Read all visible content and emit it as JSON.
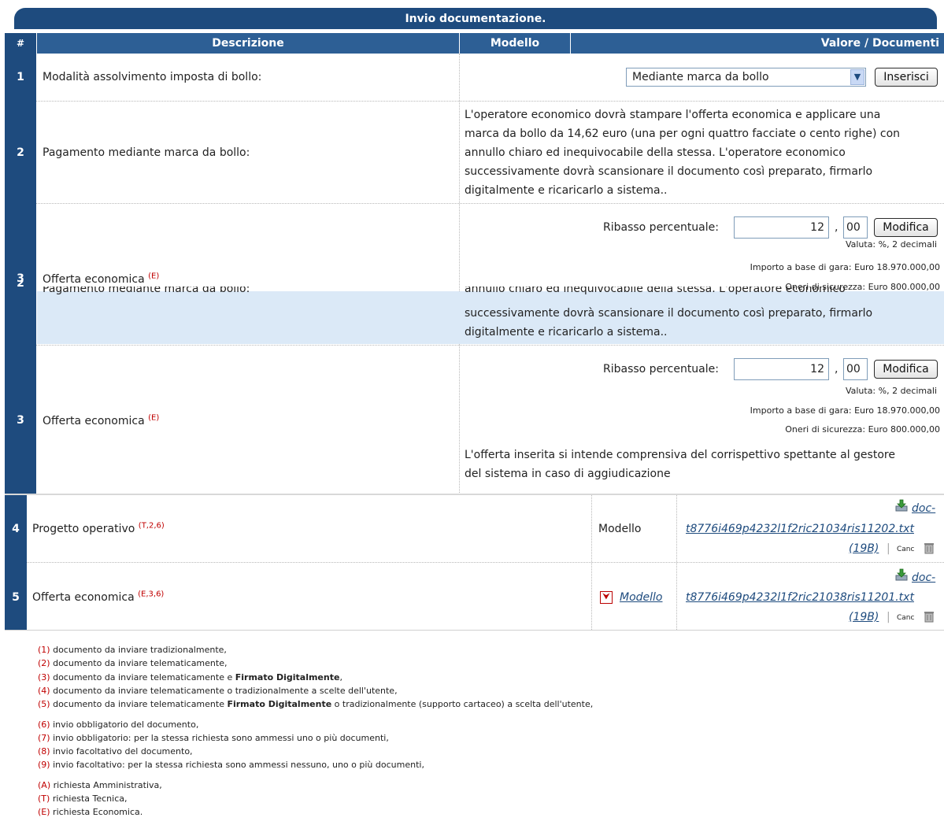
{
  "table": {
    "caption": "Invio documentazione.",
    "headers": {
      "num": "#",
      "descrizione": "Descrizione",
      "modello": "Modello",
      "valore": "Valore / Documenti"
    }
  },
  "rows": [
    {
      "num": "1",
      "desc": "Modalità assolvimento imposta di bollo:",
      "select_value": "Mediante marca da bollo",
      "button": "Inserisci"
    },
    {
      "num": "2",
      "desc": "Pagamento mediante marca da bollo:",
      "text_lines": [
        "L'operatore economico dovrà stampare l'offerta economica e applicare una",
        "marca da bollo da 14,62 euro (una per ogni quattro facciate o cento righe) con",
        "annullo chiaro ed inequivocabile della stessa. L'operatore economico",
        "successivamente dovrà scansionare il documento così preparato, firmarlo",
        "digitalmente e ricaricarlo a sistema.."
      ]
    },
    {
      "num": "3",
      "desc": "Offerta economica",
      "sup": "(E)",
      "ribasso_label": "Ribasso percentuale:",
      "int_value": "12",
      "comma": ",",
      "dec_value": "00",
      "button": "Modifica",
      "valuta": "Valuta: %, 2 decimali",
      "importo": "Importo a base di gara: Euro 18.970.000,00",
      "oneri": "Oneri di sicurezza: Euro 800.000,00",
      "note_lines": [
        "L'offerta inserita si intende comprensiva del corrispettivo spettante al gestore",
        "del sistema in caso di aggiudicazione"
      ]
    },
    {
      "num": "4",
      "desc": "Progetto operativo",
      "sup": "(T,2,6)",
      "modello": "Modello",
      "doc_link_1": "doc-",
      "doc_link_2": "t8776i469p4232l1f2ric21034ris11202.txt",
      "size": "(19B)",
      "sep": "|",
      "canc": "Canc"
    },
    {
      "num": "5",
      "desc": "Offerta economica",
      "sup": "(E,3,6)",
      "modello": "Modello",
      "doc_link_1": "doc-",
      "doc_link_2": "t8776i469p4232l1f2ric21038ris11201.txt",
      "size": "(19B)",
      "sep": "|",
      "canc": "Canc"
    }
  ],
  "ghost": {
    "num_a": "3",
    "num_b": "2",
    "desc_a": "Offerta economica",
    "sup_a": "(E)",
    "desc_b": "Pagamento mediante marca da bollo:",
    "line_a": "annullo chiaro ed inequivocabile della stessa. L'operatore economico",
    "line_b": "successivamente dovrà scansionare il documento così preparato, firmarlo",
    "line_c": "digitalmente e ricaricarlo a sistema..",
    "ribasso_label": "Ribasso percentuale:",
    "int_value": "12",
    "comma": ",",
    "dec_value": "00",
    "button": "Modifica",
    "valuta": "Valuta: %, 2 decimali",
    "importo": "Importo a base di gara: Euro 18.970.000,00",
    "oneri": "Oneri di sicurezza: Euro 800.000,00"
  },
  "legend": [
    {
      "k": "(1)",
      "t": "documento da inviare tradizionalmente,"
    },
    {
      "k": "(2)",
      "t": "documento da inviare telematicamente,"
    },
    {
      "k": "(3)",
      "t": "documento da inviare telematicamente e ",
      "b": "Firmato Digitalmente",
      "t2": ","
    },
    {
      "k": "(4)",
      "t": "documento da inviare telematicamente o tradizionalmente a scelte dell'utente,"
    },
    {
      "k": "(5)",
      "t": "documento da inviare telematicamente ",
      "b": "Firmato Digitalmente",
      "t2": " o tradizionalmente (supporto cartaceo) a scelta dell'utente,"
    },
    {
      "k": "(6)",
      "t": "invio obbligatorio del documento,"
    },
    {
      "k": "(7)",
      "t": "invio obbligatorio: per la stessa richiesta sono ammessi uno o più documenti,"
    },
    {
      "k": "(8)",
      "t": "invio facoltativo del documento,"
    },
    {
      "k": "(9)",
      "t": "invio facoltativo: per la stessa richiesta sono ammessi nessuno, uno o più documenti,"
    },
    {
      "k": "(A)",
      "t": "richiesta Amministrativa,"
    },
    {
      "k": "(T)",
      "t": "richiesta Tecnica,"
    },
    {
      "k": "(E)",
      "t": "richiesta Economica."
    }
  ]
}
